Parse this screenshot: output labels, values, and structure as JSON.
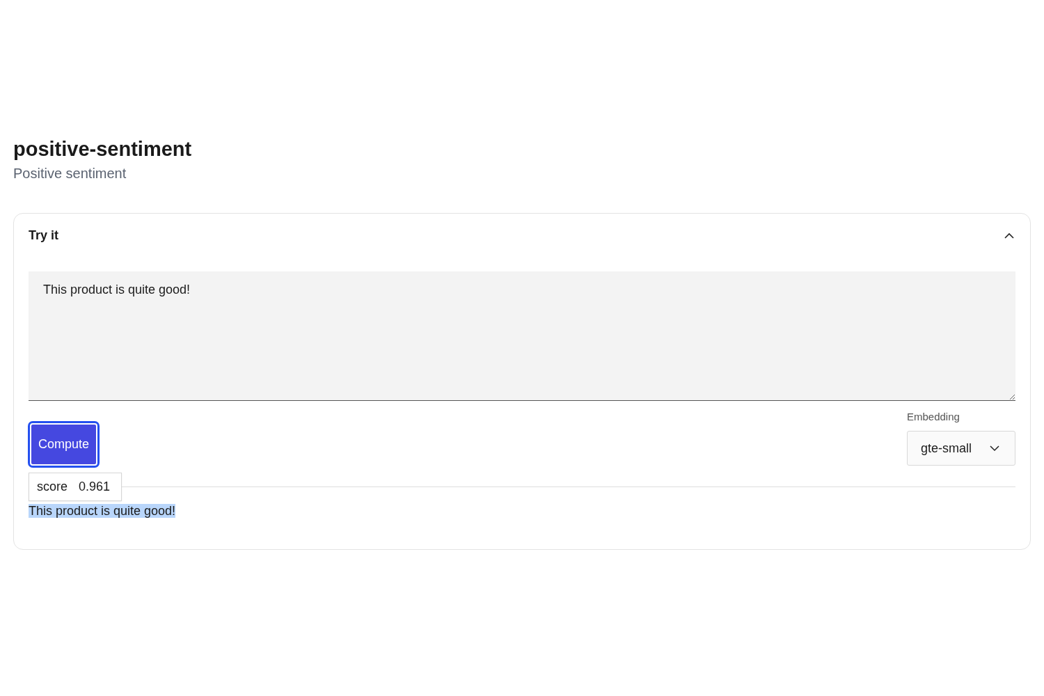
{
  "header": {
    "title": "positive-sentiment",
    "subtitle": "Positive sentiment"
  },
  "panel": {
    "title": "Try it",
    "expanded": true,
    "input": {
      "value": "This product is quite good!"
    },
    "compute_button": {
      "label": "Compute",
      "focused": true
    },
    "embedding": {
      "label": "Embedding",
      "value": "gte-small"
    },
    "result": {
      "score_label": "score",
      "score": "0.961",
      "text": "This product is quite good!",
      "selected": true
    }
  }
}
